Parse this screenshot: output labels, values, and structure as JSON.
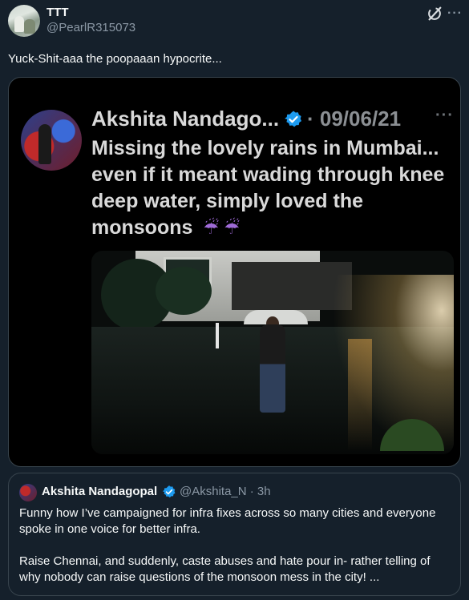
{
  "post": {
    "author_name": "TTT",
    "author_handle": "@PearlR315073",
    "text": "Yuck-Shit-aaa the poopaaan hypocrite...",
    "more_icon": "more-horizontal-icon",
    "grok_icon": "grok-icon"
  },
  "media": {
    "inner_author": "Akshita Nandago...",
    "inner_date": "· 09/06/21",
    "inner_text": "Missing the lovely rains in Mumbai... even if it meant wading through knee deep water, simply loved the monsoons",
    "inner_emoji": "☔ ☔",
    "inner_more": "···"
  },
  "quote": {
    "author_name": "Akshita Nandagopal",
    "handle_time": "@Akshita_N · 3h",
    "paragraph1": "Funny how I’ve campaigned for infra fixes across so many cities and everyone spoke in one voice for better infra.",
    "paragraph2": "Raise Chennai, and suddenly, caste abuses and hate pour in- rather telling of why nobody can raise questions of the monsoon mess in the city! ..."
  },
  "colors": {
    "background": "#15202b",
    "verified_blue": "#1d9bf0",
    "secondary_text": "#8b98a5",
    "border": "#38444d"
  }
}
